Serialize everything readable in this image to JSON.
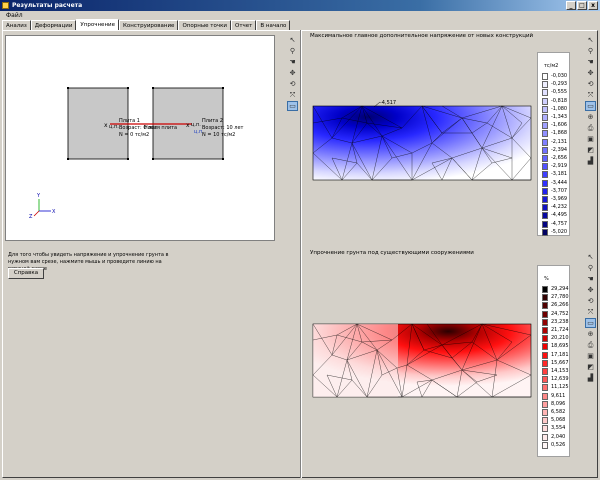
{
  "window": {
    "title": "Результаты расчета",
    "min": "_",
    "max": "□",
    "close": "x"
  },
  "menu": {
    "file": "Файл"
  },
  "tabs": [
    "Анализ",
    "Деформации",
    "Упрочнение",
    "Конструирование",
    "Опорные точки",
    "Отчет",
    "В начало"
  ],
  "scheme": {
    "plate1": {
      "marker": "ц.п.",
      "lines": [
        "Плита 1",
        "Возраст: 0 лет",
        "N = 0 тс/м2"
      ]
    },
    "plate2": {
      "marker": "ц.п.",
      "lines": [
        "Плита 2",
        "Возраст: 10 лет",
        "N = 10 тс/м2"
      ]
    },
    "new_plate": "Новая плита",
    "axes": {
      "x": "X",
      "y": "Y",
      "z": "Z"
    }
  },
  "hint": "Для того чтобы увидеть напряжение и упрочнение грунта в нужном вам срезе, нажмите мышь и проведите линию на верхней схеме",
  "help_button": "Справка",
  "stress_panel": {
    "title": "Максимальное главное дополнительное напряжение от новых конструкций",
    "annotation": "-4,517",
    "unit": "тс/м2",
    "values": [
      "-0,030",
      "-0,293",
      "-0,555",
      "-0,818",
      "-1,080",
      "-1,343",
      "-1,606",
      "-1,868",
      "-2,131",
      "-2,394",
      "-2,656",
      "-2,919",
      "-3,181",
      "-3,444",
      "-3,707",
      "-3,969",
      "-4,232",
      "-4,495",
      "-4,757",
      "-5,020"
    ],
    "colors": [
      "#ffffff",
      "#efefff",
      "#e0e0ff",
      "#d0d0ff",
      "#c0c0ff",
      "#b0b0ff",
      "#a0a0ff",
      "#9090ff",
      "#8080ff",
      "#7070ff",
      "#6060ff",
      "#5050ff",
      "#4040ff",
      "#3030ff",
      "#2020f0",
      "#1818d8",
      "#1010c0",
      "#0808a0",
      "#040480",
      "#000060"
    ]
  },
  "hardening_panel": {
    "title": "Упрочнение грунта под существующими сооружениями",
    "unit": "%",
    "values": [
      "29,294",
      "27,780",
      "26,266",
      "24,752",
      "23,238",
      "21,724",
      "20,210",
      "18,695",
      "17,181",
      "15,667",
      "14,153",
      "12,639",
      "11,125",
      "9,611",
      "8,096",
      "6,582",
      "5,068",
      "3,554",
      "2,040",
      "0,526"
    ],
    "colors": [
      "#000000",
      "#300000",
      "#500000",
      "#700000",
      "#900000",
      "#b00000",
      "#d00000",
      "#f00000",
      "#ff1010",
      "#ff2828",
      "#ff4040",
      "#ff5858",
      "#ff7070",
      "#ff8888",
      "#ffa0a0",
      "#ffb4b4",
      "#ffc8c8",
      "#ffdcdc",
      "#ffeaea",
      "#fff6f6"
    ]
  },
  "toolbar_icons": [
    "pointer-icon",
    "zoom-icon",
    "pan-hand-icon",
    "move-icon",
    "rotate-3d-icon",
    "fit-icon",
    "select-frame-icon",
    "zoom-in-icon",
    "printer-icon",
    "save-icon",
    "eraser-icon",
    "chart-icon"
  ]
}
